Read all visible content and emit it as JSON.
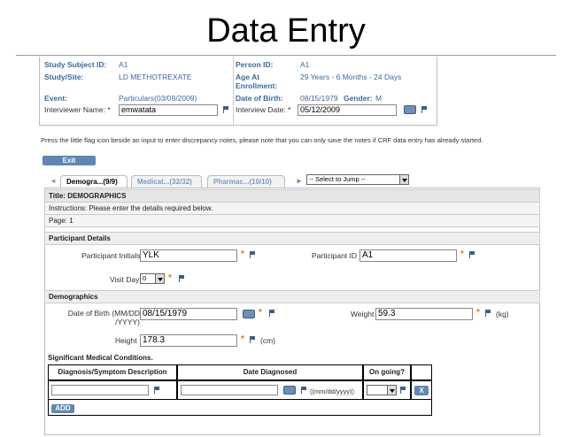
{
  "slide": {
    "title": "Data Entry"
  },
  "subject": {
    "study_subject_id_label": "Study Subject ID:",
    "study_subject_id": "A1",
    "person_id_label": "Person ID:",
    "person_id": "A1",
    "study_site_label": "Study/Site:",
    "study_site": "LD METHOTREXATE",
    "age_label": "Age At Enrollment:",
    "age": "29 Years - 6 Months - 24 Days",
    "event_label": "Event:",
    "event": "Particulars(03/09/2009)",
    "dob_label": "Date of Birth:",
    "dob": "08/15/1979",
    "gender_label": "Gender:",
    "gender": "M",
    "interviewer_label": "Interviewer Name: *",
    "interviewer": "emwatata",
    "interview_date_label": "Interview Date: *",
    "interview_date": "05/12/2009"
  },
  "notice": "Press the little flag icon beside an input to enter discrepancy notes, please note that you can only save the notes if CRF data entry has already started.",
  "exit_label": "Exit",
  "tabs": [
    {
      "label": "Demogra...(9/9)"
    },
    {
      "label": "Medicat...(32/32)"
    },
    {
      "label": "Pharmac...(10/10)"
    }
  ],
  "jump": "-- Select to Jump --",
  "crf": {
    "title": "Title: DEMOGRAPHICS",
    "instructions": "Instructions: Please enter the details required below.",
    "page": "Page: 1",
    "participant_details": "Participant Details",
    "initials_label": "Participant Initials",
    "initials": "YLK",
    "pid_label": "Participant ID",
    "pid": "A1",
    "visit_day_label": "Visit Day",
    "visit_day": "0",
    "demographics": "Demographics",
    "dob_label": "Date of Birth (MM/DD /YYYY)",
    "dob": "08/15/1979",
    "weight_label": "Weight",
    "weight": "59.3",
    "weight_unit": "(kg)",
    "height_label": "Height",
    "height": "178.3",
    "height_unit": "(cm)",
    "conditions": "Significant Medical Conditions.",
    "col_diag": "Diagnosis/Symptom Description",
    "col_date": "Date Diagnosed",
    "col_ongoing": "On going?",
    "date_hint": "((mm/dd/yyyy))",
    "remove": "X",
    "add": "ADD"
  }
}
